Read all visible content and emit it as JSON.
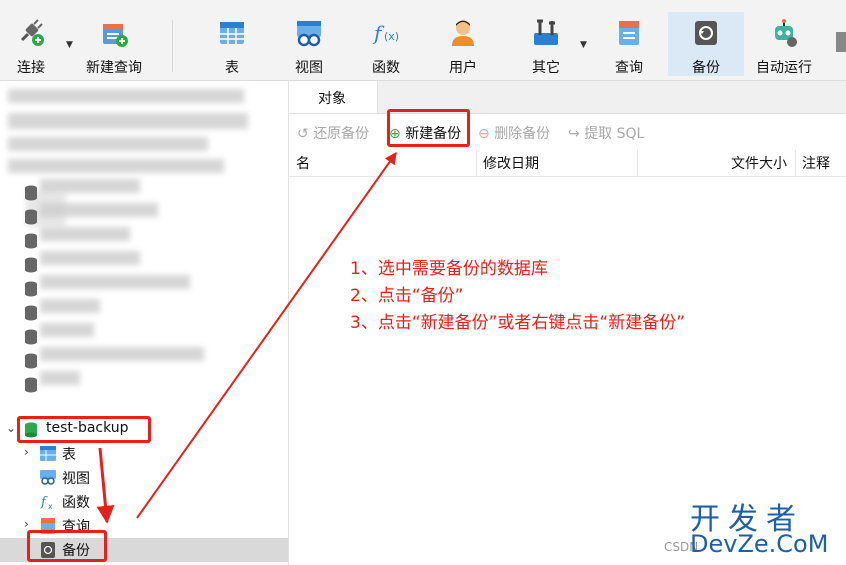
{
  "toolbar": {
    "connect": "连接",
    "new_query": "新建查询",
    "table": "表",
    "view": "视图",
    "function": "函数",
    "user": "用户",
    "other": "其它",
    "query": "查询",
    "backup": "备份",
    "automation": "自动运行"
  },
  "tabs": {
    "objects": "对象"
  },
  "subtoolbar": {
    "restore": "还原备份",
    "new_backup": "新建备份",
    "delete": "删除备份",
    "extract": "提取 SQL"
  },
  "columns": {
    "name": "名",
    "modified": "修改日期",
    "size": "文件大小",
    "comment": "注释"
  },
  "tree": {
    "database": "test-backup",
    "children": {
      "tables": "表",
      "views": "视图",
      "functions": "函数",
      "queries": "查询",
      "backups": "备份"
    }
  },
  "annotation": {
    "step1": "1、选中需要备份的数据库",
    "step2": "2、点击“备份”",
    "step3": "3、点击“新建备份”或者右键点击“新建备份”"
  },
  "watermark": {
    "cn": "开发者",
    "domain": "DevZe.CoM",
    "csdn": "CSDN"
  },
  "colors": {
    "annotation_red": "#e8201a",
    "watermark_blue": "#1f5fa8",
    "db_green": "#2aa84a"
  }
}
